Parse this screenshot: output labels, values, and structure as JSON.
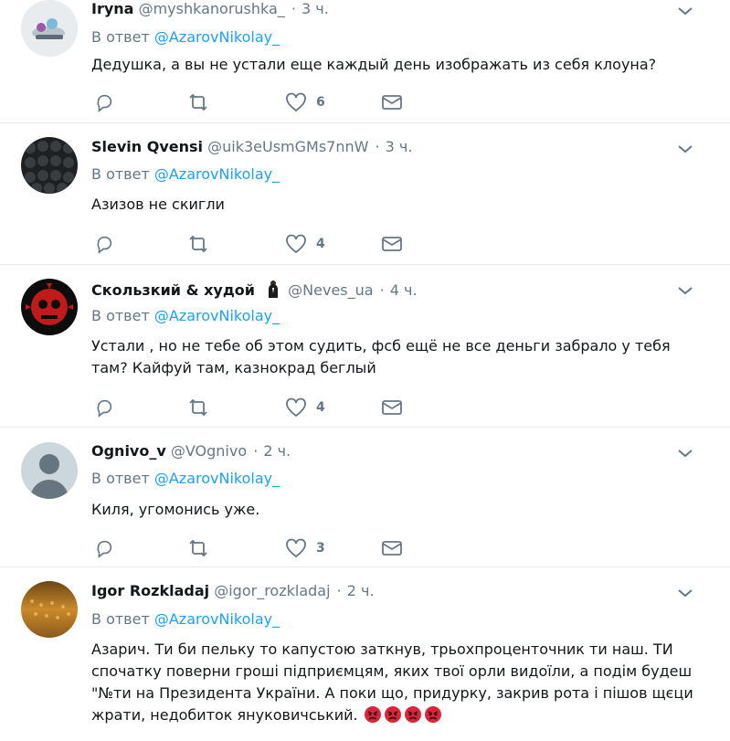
{
  "reply_prefix": "В ответ",
  "colors": {
    "link": "#1da1f2",
    "muted": "#657786",
    "text": "#14171a",
    "divider": "#e6ecf0"
  },
  "tweets": [
    {
      "name": "Iryna",
      "handle": "@myshkanorushka_",
      "time": "3 ч.",
      "reply_to": "@AzarovNikolay_",
      "text": "Дедушка, а вы не устали еще каждый день изображать из себя клоуна?",
      "likes": "6"
    },
    {
      "name": "Slevin Qvensi",
      "handle": "@uik3eUsmGMs7nnW",
      "time": "3 ч.",
      "reply_to": "@AzarovNikolay_",
      "text": "Азизов не скигли",
      "likes": "4"
    },
    {
      "name": "Скользкий & худой",
      "name_emoji": "man-in-suit-icon",
      "handle": "@Neves_ua",
      "time": "4 ч.",
      "reply_to": "@AzarovNikolay_",
      "text": "Устали , но не тебе об этом судить, фсб ещё не все деньги забрало у тебя там? Кайфуй там, казнокрад беглый",
      "likes": "4"
    },
    {
      "name": "Ognivo_v",
      "handle": "@VOgnivo",
      "time": "2 ч.",
      "reply_to": "@AzarovNikolay_",
      "text": "Киля, угомонись уже.",
      "likes": "3"
    },
    {
      "name": "Igor Rozkladaj",
      "handle": "@igor_rozkladaj",
      "time": "2 ч.",
      "reply_to": "@AzarovNikolay_",
      "text": "Азарич. Ти би пельку то капустою заткнув, трьохпроценточник ти наш. ТИ спочатку поверни гроші підприємцям, яких твої орли видоїли, а подім будеш \"№ти на Президента України. А поки що, придурку, закрив рота і пішов щєци жрати, недобиток януковичський.",
      "trailing_emoji": [
        "angry-face-icon",
        "angry-face-icon",
        "angry-face-icon",
        "angry-face-icon"
      ]
    }
  ]
}
